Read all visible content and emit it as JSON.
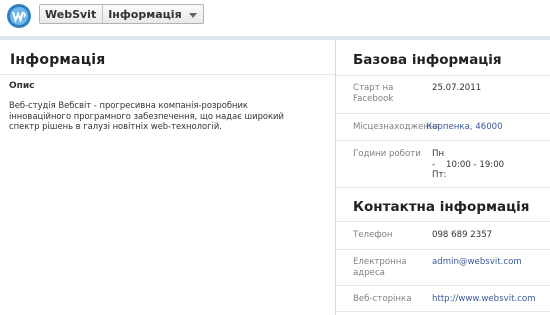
{
  "header": {
    "page_name": "WebSvit",
    "current_tab": "Інформація"
  },
  "colors": {
    "accent": "#3b5998",
    "divider": "#dfe3ee",
    "label_gray": "#808080"
  },
  "info_section": {
    "title": "Інформація",
    "about_label": "Опис",
    "about_text": "Веб-студія Вебсвіт - прогресивна компанія-розробник інноваційного програмного забезпечення, що надає широкий спектр рішень в галузі новітніх web-технологій."
  },
  "basic_info": {
    "title": "Базова інформація",
    "start_label": "Старт на Facebook",
    "start_value": "25.07.2011",
    "location_label": "Місцезнаходження",
    "location_value": "Карпенка, 46000",
    "hours_label": "Години роботи",
    "hours_value": "Пн\n-    10:00 - 19:00\nПт:"
  },
  "contact_info": {
    "title": "Контактна інформація",
    "phone_label": "Телефон",
    "phone_value": "098 689 2357",
    "email_label": "Електронна адреса",
    "email_value": "admin@websvit.com",
    "web_label": "Веб-сторінка",
    "web_value": "http://www.websvit.com"
  }
}
